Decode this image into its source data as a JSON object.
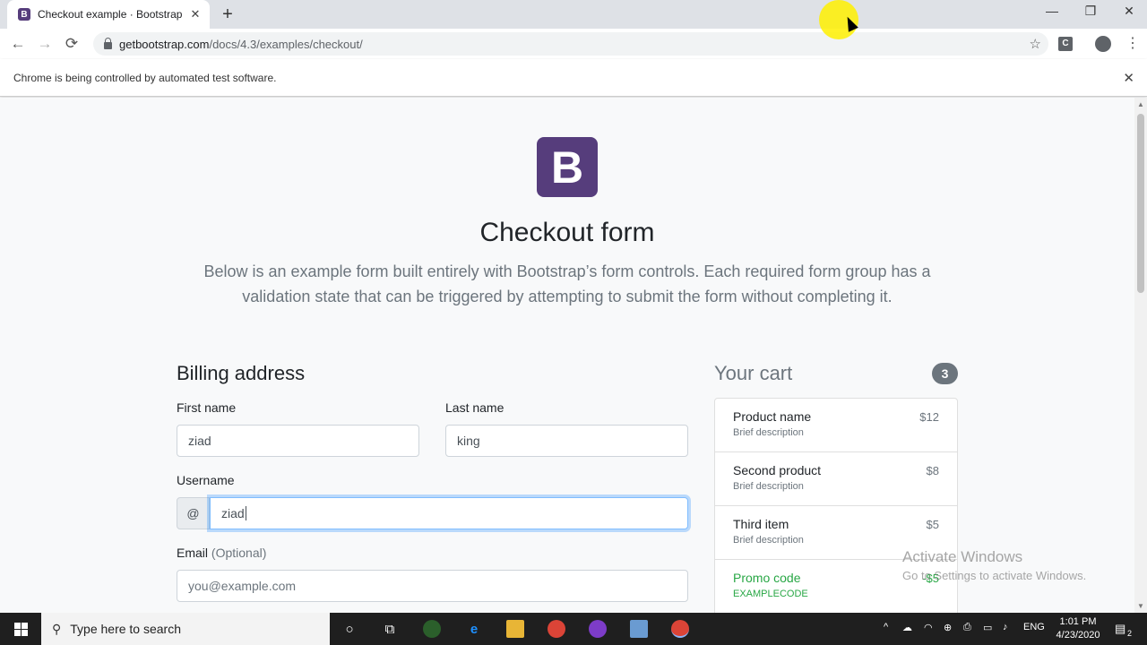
{
  "browser": {
    "tab_title": "Checkout example · Bootstrap",
    "url_domain": "getbootstrap.com",
    "url_path": "/docs/4.3/examples/checkout/",
    "infobar_text": "Chrome is being controlled by automated test software.",
    "icons": {
      "back": "←",
      "forward": "→",
      "reload": "⟳",
      "star": "☆",
      "close": "✕",
      "new_tab": "+",
      "minimize": "—",
      "restore": "❐",
      "menu": "⋮",
      "ext_c": "C"
    }
  },
  "page": {
    "logo_letter": "B",
    "title": "Checkout form",
    "lead": "Below is an example form built entirely with Bootstrap’s form controls. Each required form group has a validation state that can be triggered by attempting to submit the form without completing it."
  },
  "billing": {
    "heading": "Billing address",
    "first_name_label": "First name",
    "first_name_value": "ziad",
    "last_name_label": "Last name",
    "last_name_value": "king",
    "username_label": "Username",
    "username_prefix": "@",
    "username_value": "ziad",
    "email_label": "Email",
    "email_optional": "(Optional)",
    "email_placeholder": "you@example.com"
  },
  "cart": {
    "heading": "Your cart",
    "count": "3",
    "items": [
      {
        "name": "Product name",
        "desc": "Brief description",
        "price": "$12"
      },
      {
        "name": "Second product",
        "desc": "Brief description",
        "price": "$8"
      },
      {
        "name": "Third item",
        "desc": "Brief description",
        "price": "$5"
      }
    ],
    "promo": {
      "name": "Promo code",
      "code": "EXAMPLECODE",
      "price": "-$5"
    }
  },
  "watermark": {
    "line1": "Activate Windows",
    "line2": "Go to Settings to activate Windows."
  },
  "taskbar": {
    "search_placeholder": "Type here to search",
    "language": "ENG",
    "time": "1:01 PM",
    "date": "4/23/2020",
    "notification_count": "2"
  },
  "colors": {
    "bootstrap_purple": "#563d7c",
    "success_green": "#28a745",
    "muted": "#6c757d",
    "focus_ring": "#80bdff"
  }
}
